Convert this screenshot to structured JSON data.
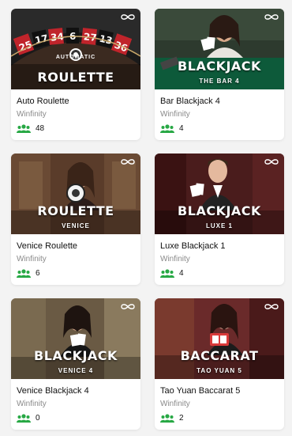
{
  "colors": {
    "players_icon": "#27a844"
  },
  "games": [
    {
      "name": "Auto Roulette",
      "provider": "Winfinity",
      "players": "48",
      "thumb_title": "ROULETTE",
      "thumb_top": "AUTOMATIC",
      "thumb_sub": ""
    },
    {
      "name": "Bar Blackjack 4",
      "provider": "Winfinity",
      "players": "4",
      "thumb_title": "BLACKJACK",
      "thumb_sub": "THE BAR 4"
    },
    {
      "name": "Venice Roulette",
      "provider": "Winfinity",
      "players": "6",
      "thumb_title": "ROULETTE",
      "thumb_sub": "VENICE"
    },
    {
      "name": "Luxe Blackjack 1",
      "provider": "Winfinity",
      "players": "4",
      "thumb_title": "BLACKJACK",
      "thumb_sub": "LUXE 1"
    },
    {
      "name": "Venice Blackjack 4",
      "provider": "Winfinity",
      "players": "0",
      "thumb_title": "BLACKJACK",
      "thumb_sub": "VENICE 4"
    },
    {
      "name": "Tao Yuan Baccarat 5",
      "provider": "Winfinity",
      "players": "2",
      "thumb_title": "BACCARAT",
      "thumb_sub": "TAO YUAN 5"
    }
  ],
  "roulette_numbers": [
    "25",
    "17",
    "34",
    "6",
    "27",
    "13",
    "36"
  ]
}
